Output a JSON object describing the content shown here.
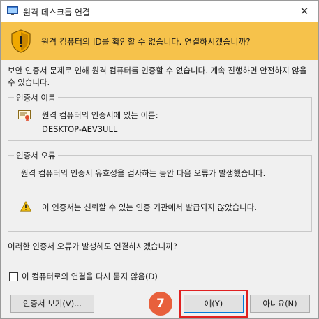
{
  "window": {
    "title": "원격 데스크톱 연결",
    "close_glyph": "✕"
  },
  "banner": {
    "text": "원격 컴퓨터의 ID를 확인할 수 없습니다. 연결하시겠습니까?",
    "color": "#f6c24b"
  },
  "intro": "보안 인증서 문제로 인해 원격 컴퓨터를 인증할 수 없습니다. 계속 진행하면 안전하지 않을 수 있습니다.",
  "cert_name": {
    "legend": "인증서 이름",
    "label": "원격 컴퓨터의 인증서에 있는 이름:",
    "value": "DESKTOP-AEV3ULL"
  },
  "cert_errors": {
    "legend": "인증서 오류",
    "description": "원격 컴퓨터의 인증서 유효성을 검사하는 동안 다음 오류가 발생했습니다.",
    "items": [
      "이 인증서는 신뢰할 수 있는 인증 기관에서 발급되지 않았습니다."
    ]
  },
  "question": "이러한 인증서 오류가 발생해도 연결하시겠습니까?",
  "checkbox": {
    "label": "이 컴퓨터로의 연결을 다시 묻지 않음(D)",
    "checked": false
  },
  "buttons": {
    "view_cert": "인증서 보기(V)...",
    "yes": "예(Y)",
    "no": "아니요(N)"
  },
  "annotation": {
    "step_number": "7",
    "badge_color": "#e8603c",
    "highlight_color": "#e02020"
  }
}
